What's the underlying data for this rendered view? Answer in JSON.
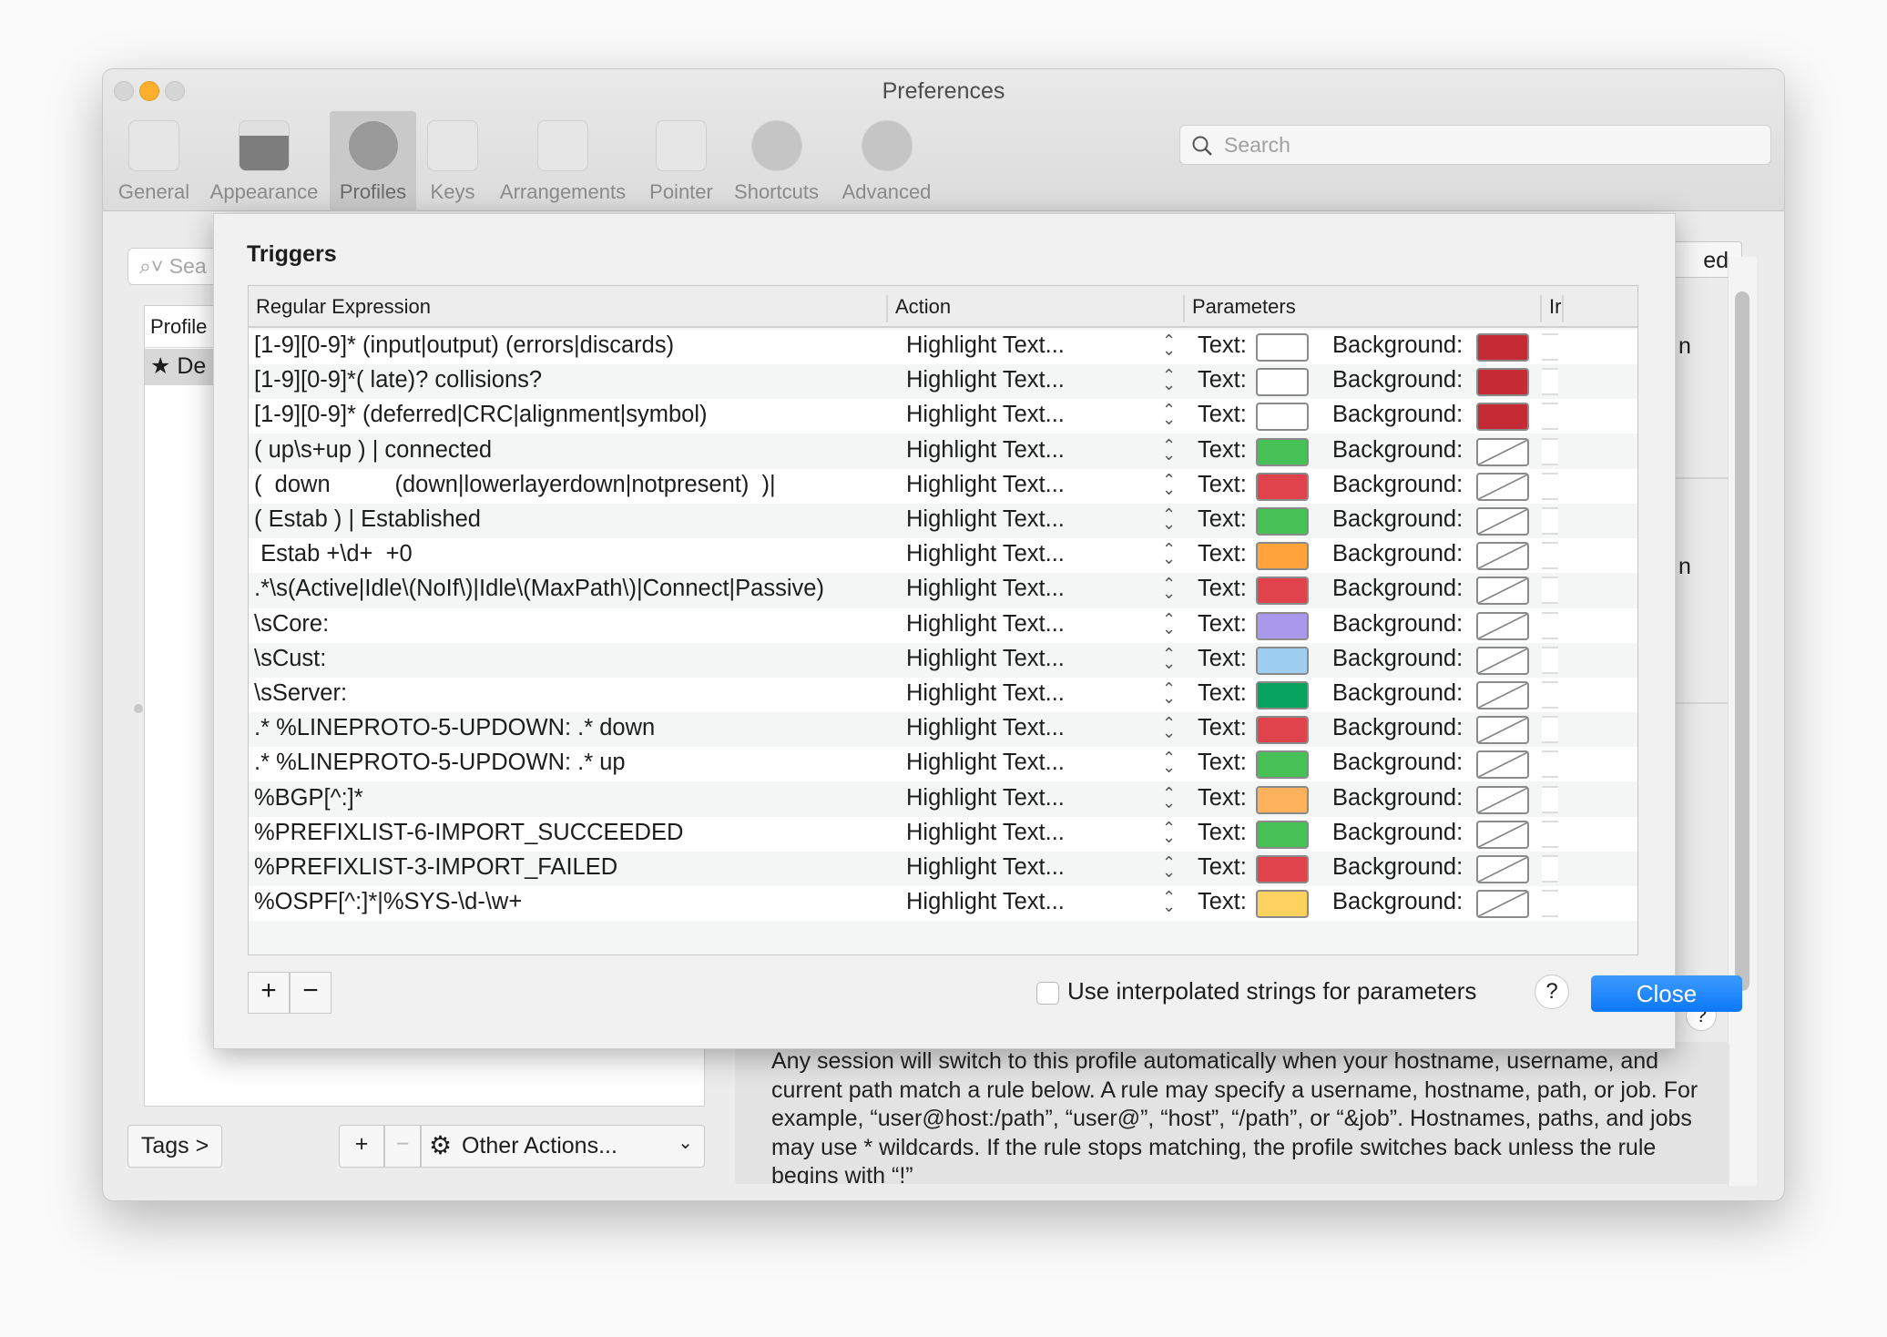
{
  "window": {
    "title": "Preferences",
    "search_placeholder": "Search"
  },
  "toolbar": [
    {
      "label": "General",
      "icon": "switch-icon"
    },
    {
      "label": "Appearance",
      "icon": "window-icon"
    },
    {
      "label": "Profiles",
      "icon": "person-icon",
      "selected": true
    },
    {
      "label": "Keys",
      "icon": "command-key-icon"
    },
    {
      "label": "Arrangements",
      "icon": "windows-icon"
    },
    {
      "label": "Pointer",
      "icon": "mouse-icon"
    },
    {
      "label": "Shortcuts",
      "icon": "lightning-icon"
    },
    {
      "label": "Advanced",
      "icon": "gear-icon"
    }
  ],
  "background": {
    "search_placeholder": "Sea",
    "profile_header": "Profile",
    "profile_row": "★ De",
    "tags_label": "Tags >",
    "add": "+",
    "remove": "−",
    "other_actions": "Other Actions...",
    "right_button": "ed",
    "right_frag1": "n",
    "right_frag2": "n",
    "help": "?",
    "description": "Any session will switch to this profile automatically when your hostname, username, and current path match a rule below. A rule may specify a username, hostname, path, or job. For example, “user@host:/path”, “user@”, “host”, “/path”, or “&job”. Hostnames, paths, and jobs may use * wildcards. If the rule stops matching, the profile switches back unless the rule begins with “!”"
  },
  "sheet": {
    "title": "Triggers",
    "columns": {
      "regex": "Regular Expression",
      "action": "Action",
      "params": "Parameters",
      "instant": "Ir"
    },
    "text_label": "Text:",
    "bg_label": "Background:",
    "rows": [
      {
        "regex": "[1-9][0-9]* (input|output) (errors|discards)",
        "action": "Highlight Text...",
        "text": "#ffffff",
        "bg": "#c42b35"
      },
      {
        "regex": "[1-9][0-9]*( late)? collisions?",
        "action": "Highlight Text...",
        "text": "#ffffff",
        "bg": "#c42b35"
      },
      {
        "regex": "[1-9][0-9]* (deferred|CRC|alignment|symbol)",
        "action": "Highlight Text...",
        "text": "#ffffff",
        "bg": "#c42b35"
      },
      {
        "regex": "( up\\s+up ) | connected",
        "action": "Highlight Text...",
        "text": "#46c155",
        "bg": null
      },
      {
        "regex": "(  down          (down|lowerlayerdown|notpresent)  )|",
        "action": "Highlight Text...",
        "text": "#e0434c",
        "bg": null
      },
      {
        "regex": "( Estab ) | Established",
        "action": "Highlight Text...",
        "text": "#46c155",
        "bg": null
      },
      {
        "regex": " Estab +\\d+  +0",
        "action": "Highlight Text...",
        "text": "#ffa33a",
        "bg": null
      },
      {
        "regex": ".*\\s(Active|Idle\\(NoIf\\)|Idle\\(MaxPath\\)|Connect|Passive)",
        "action": "Highlight Text...",
        "text": "#e0434c",
        "bg": null
      },
      {
        "regex": "\\sCore:",
        "action": "Highlight Text...",
        "text": "#a999ec",
        "bg": null
      },
      {
        "regex": "\\sCust:",
        "action": "Highlight Text...",
        "text": "#9fcff0",
        "bg": null
      },
      {
        "regex": "\\sServer:",
        "action": "Highlight Text...",
        "text": "#07a35f",
        "bg": null
      },
      {
        "regex": ".* %LINEPROTO-5-UPDOWN: .* down",
        "action": "Highlight Text...",
        "text": "#e0434c",
        "bg": null
      },
      {
        "regex": ".* %LINEPROTO-5-UPDOWN: .* up",
        "action": "Highlight Text...",
        "text": "#46c155",
        "bg": null
      },
      {
        "regex": "%BGP[^:]*",
        "action": "Highlight Text...",
        "text": "#ffb25c",
        "bg": null
      },
      {
        "regex": "%PREFIXLIST-6-IMPORT_SUCCEEDED",
        "action": "Highlight Text...",
        "text": "#46c155",
        "bg": null
      },
      {
        "regex": "%PREFIXLIST-3-IMPORT_FAILED",
        "action": "Highlight Text...",
        "text": "#e0434c",
        "bg": null
      },
      {
        "regex": "%OSPF[^:]*|%SYS-\\d-\\w+",
        "action": "Highlight Text...",
        "text": "#ffd15e",
        "bg": null
      }
    ],
    "add": "+",
    "remove": "−",
    "interpolated_label": "Use interpolated strings for parameters",
    "interpolated_checked": false,
    "help": "?",
    "close": "Close"
  },
  "colors": {
    "accent": "#1a82fb",
    "close_traffic": "#fdb02e"
  }
}
